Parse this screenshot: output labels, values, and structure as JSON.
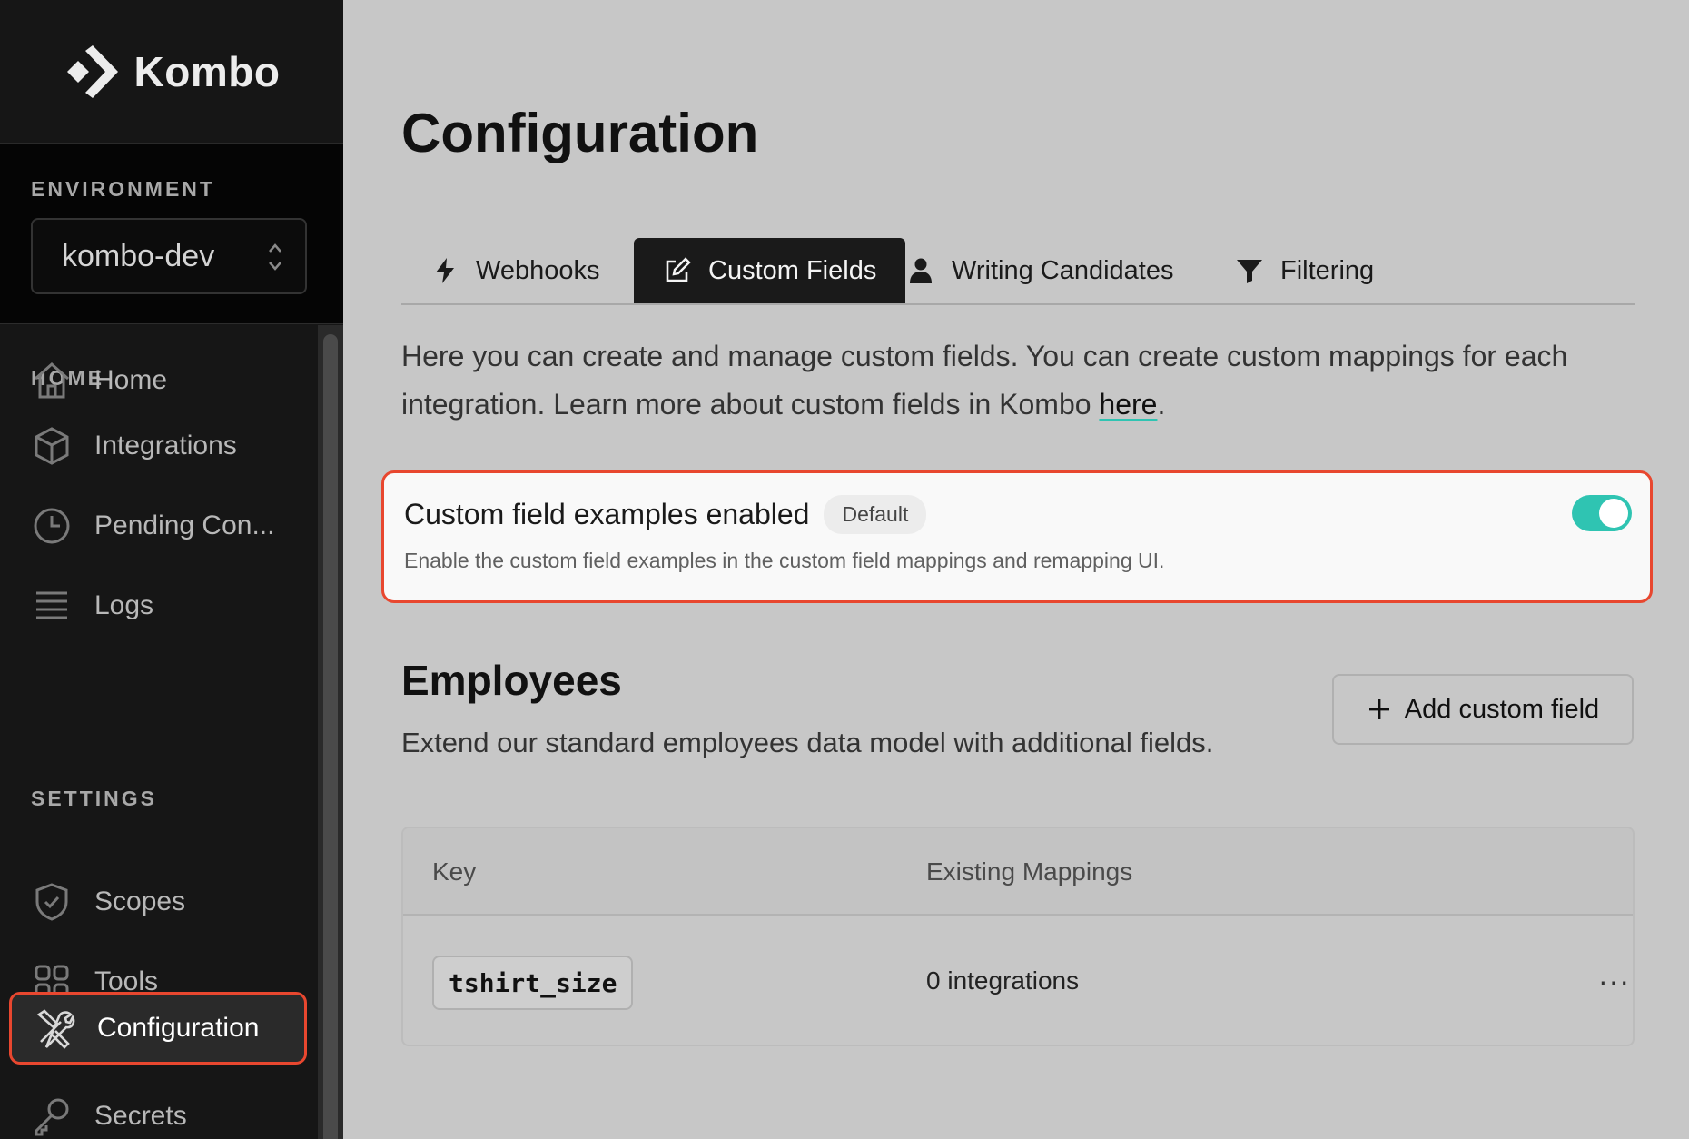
{
  "sidebar": {
    "brand": "Kombo",
    "environment_label": "ENVIRONMENT",
    "environment_value": "kombo-dev",
    "home_header": "HOME",
    "settings_header": "SETTINGS",
    "home_items": [
      {
        "label": "Home",
        "icon": "home-icon"
      },
      {
        "label": "Integrations",
        "icon": "cube-icon"
      },
      {
        "label": "Pending Con...",
        "icon": "clock-icon"
      },
      {
        "label": "Logs",
        "icon": "list-icon"
      }
    ],
    "settings_items": [
      {
        "label": "Scopes",
        "icon": "shield-check-icon"
      },
      {
        "label": "Tools",
        "icon": "grid-icon"
      },
      {
        "label": "Configuration",
        "icon": "wrench-screwdriver-icon",
        "active": true
      },
      {
        "label": "Secrets",
        "icon": "key-icon"
      }
    ]
  },
  "main": {
    "title": "Configuration",
    "tabs": [
      {
        "label": "Webhooks",
        "icon": "bolt-icon"
      },
      {
        "label": "Custom Fields",
        "icon": "edit-icon",
        "active": true
      },
      {
        "label": "Writing Candidates",
        "icon": "user-icon"
      },
      {
        "label": "Filtering",
        "icon": "filter-icon"
      }
    ],
    "intro_text": "Here you can create and manage custom fields. You can create custom mappings for each integration. Learn more about custom fields in Kombo ",
    "intro_link": "here",
    "intro_end": ".",
    "setting_card": {
      "title": "Custom field examples enabled",
      "badge": "Default",
      "description": "Enable the custom field examples in the custom field mappings and remapping UI.",
      "enabled": true
    },
    "employees": {
      "title": "Employees",
      "description": "Extend our standard employees data model with additional fields.",
      "add_button": "Add custom field",
      "columns": [
        "Key",
        "Existing Mappings"
      ],
      "rows": [
        {
          "key": "tshirt_size",
          "mappings": "0 integrations",
          "more": "···"
        }
      ]
    }
  },
  "colors": {
    "accent": "#2fc4b2",
    "highlight": "#e8472f",
    "sidebar_bg": "#161616",
    "content_bg": "#c7c7c7"
  }
}
